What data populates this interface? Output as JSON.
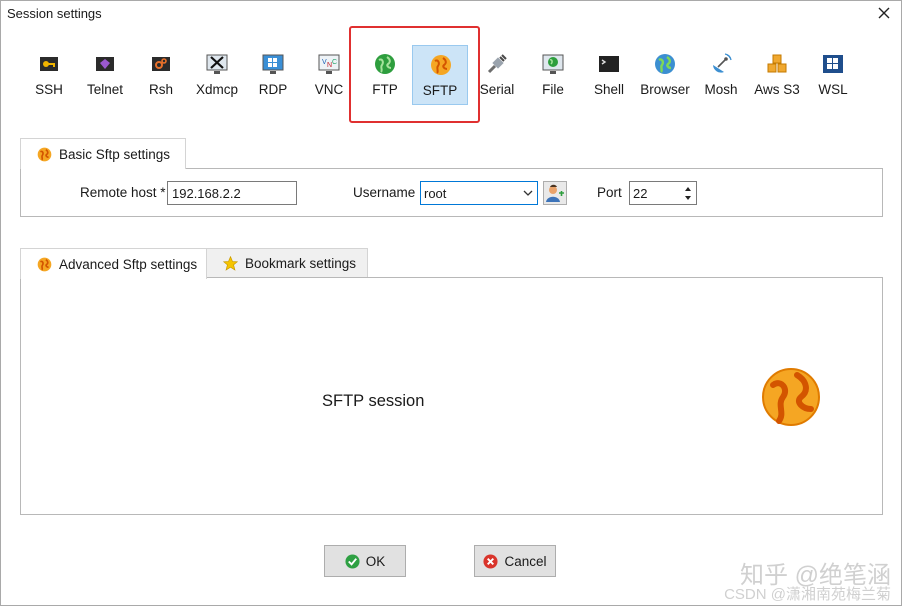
{
  "window": {
    "title": "Session settings"
  },
  "toolbar": {
    "items": [
      {
        "label": "SSH",
        "icon": "key-icon"
      },
      {
        "label": "Telnet",
        "icon": "gem-icon"
      },
      {
        "label": "Rsh",
        "icon": "gears-icon"
      },
      {
        "label": "Xdmcp",
        "icon": "x-display-icon"
      },
      {
        "label": "RDP",
        "icon": "windows-monitor-icon"
      },
      {
        "label": "VNC",
        "icon": "vnc-monitor-icon"
      },
      {
        "label": "FTP",
        "icon": "green-globe-icon"
      },
      {
        "label": "SFTP",
        "icon": "orange-globe-icon",
        "selected": true
      },
      {
        "label": "Serial",
        "icon": "serial-plug-icon"
      },
      {
        "label": "File",
        "icon": "file-monitor-icon"
      },
      {
        "label": "Shell",
        "icon": "terminal-icon"
      },
      {
        "label": "Browser",
        "icon": "browser-globe-icon"
      },
      {
        "label": "Mosh",
        "icon": "satellite-icon"
      },
      {
        "label": "Aws S3",
        "icon": "cubes-icon"
      },
      {
        "label": "WSL",
        "icon": "wsl-windows-icon"
      }
    ]
  },
  "basic": {
    "tab_label": "Basic Sftp settings",
    "remote_host_label": "Remote host *",
    "remote_host_value": "192.168.2.2",
    "username_label": "Username",
    "username_value": "root",
    "port_label": "Port",
    "port_value": "22"
  },
  "lower_tabs": {
    "advanced_label": "Advanced Sftp settings",
    "bookmark_label": "Bookmark settings"
  },
  "session": {
    "description": "SFTP session"
  },
  "buttons": {
    "ok_label": "OK",
    "cancel_label": "Cancel"
  },
  "watermark": {
    "line1": "知乎 @绝笔涵",
    "line2": "CSDN @潇湘南苑梅兰菊"
  },
  "colors": {
    "selected_bg": "#cce4f7",
    "highlight": "#e03030",
    "sftp_orange": "#f5a623"
  }
}
